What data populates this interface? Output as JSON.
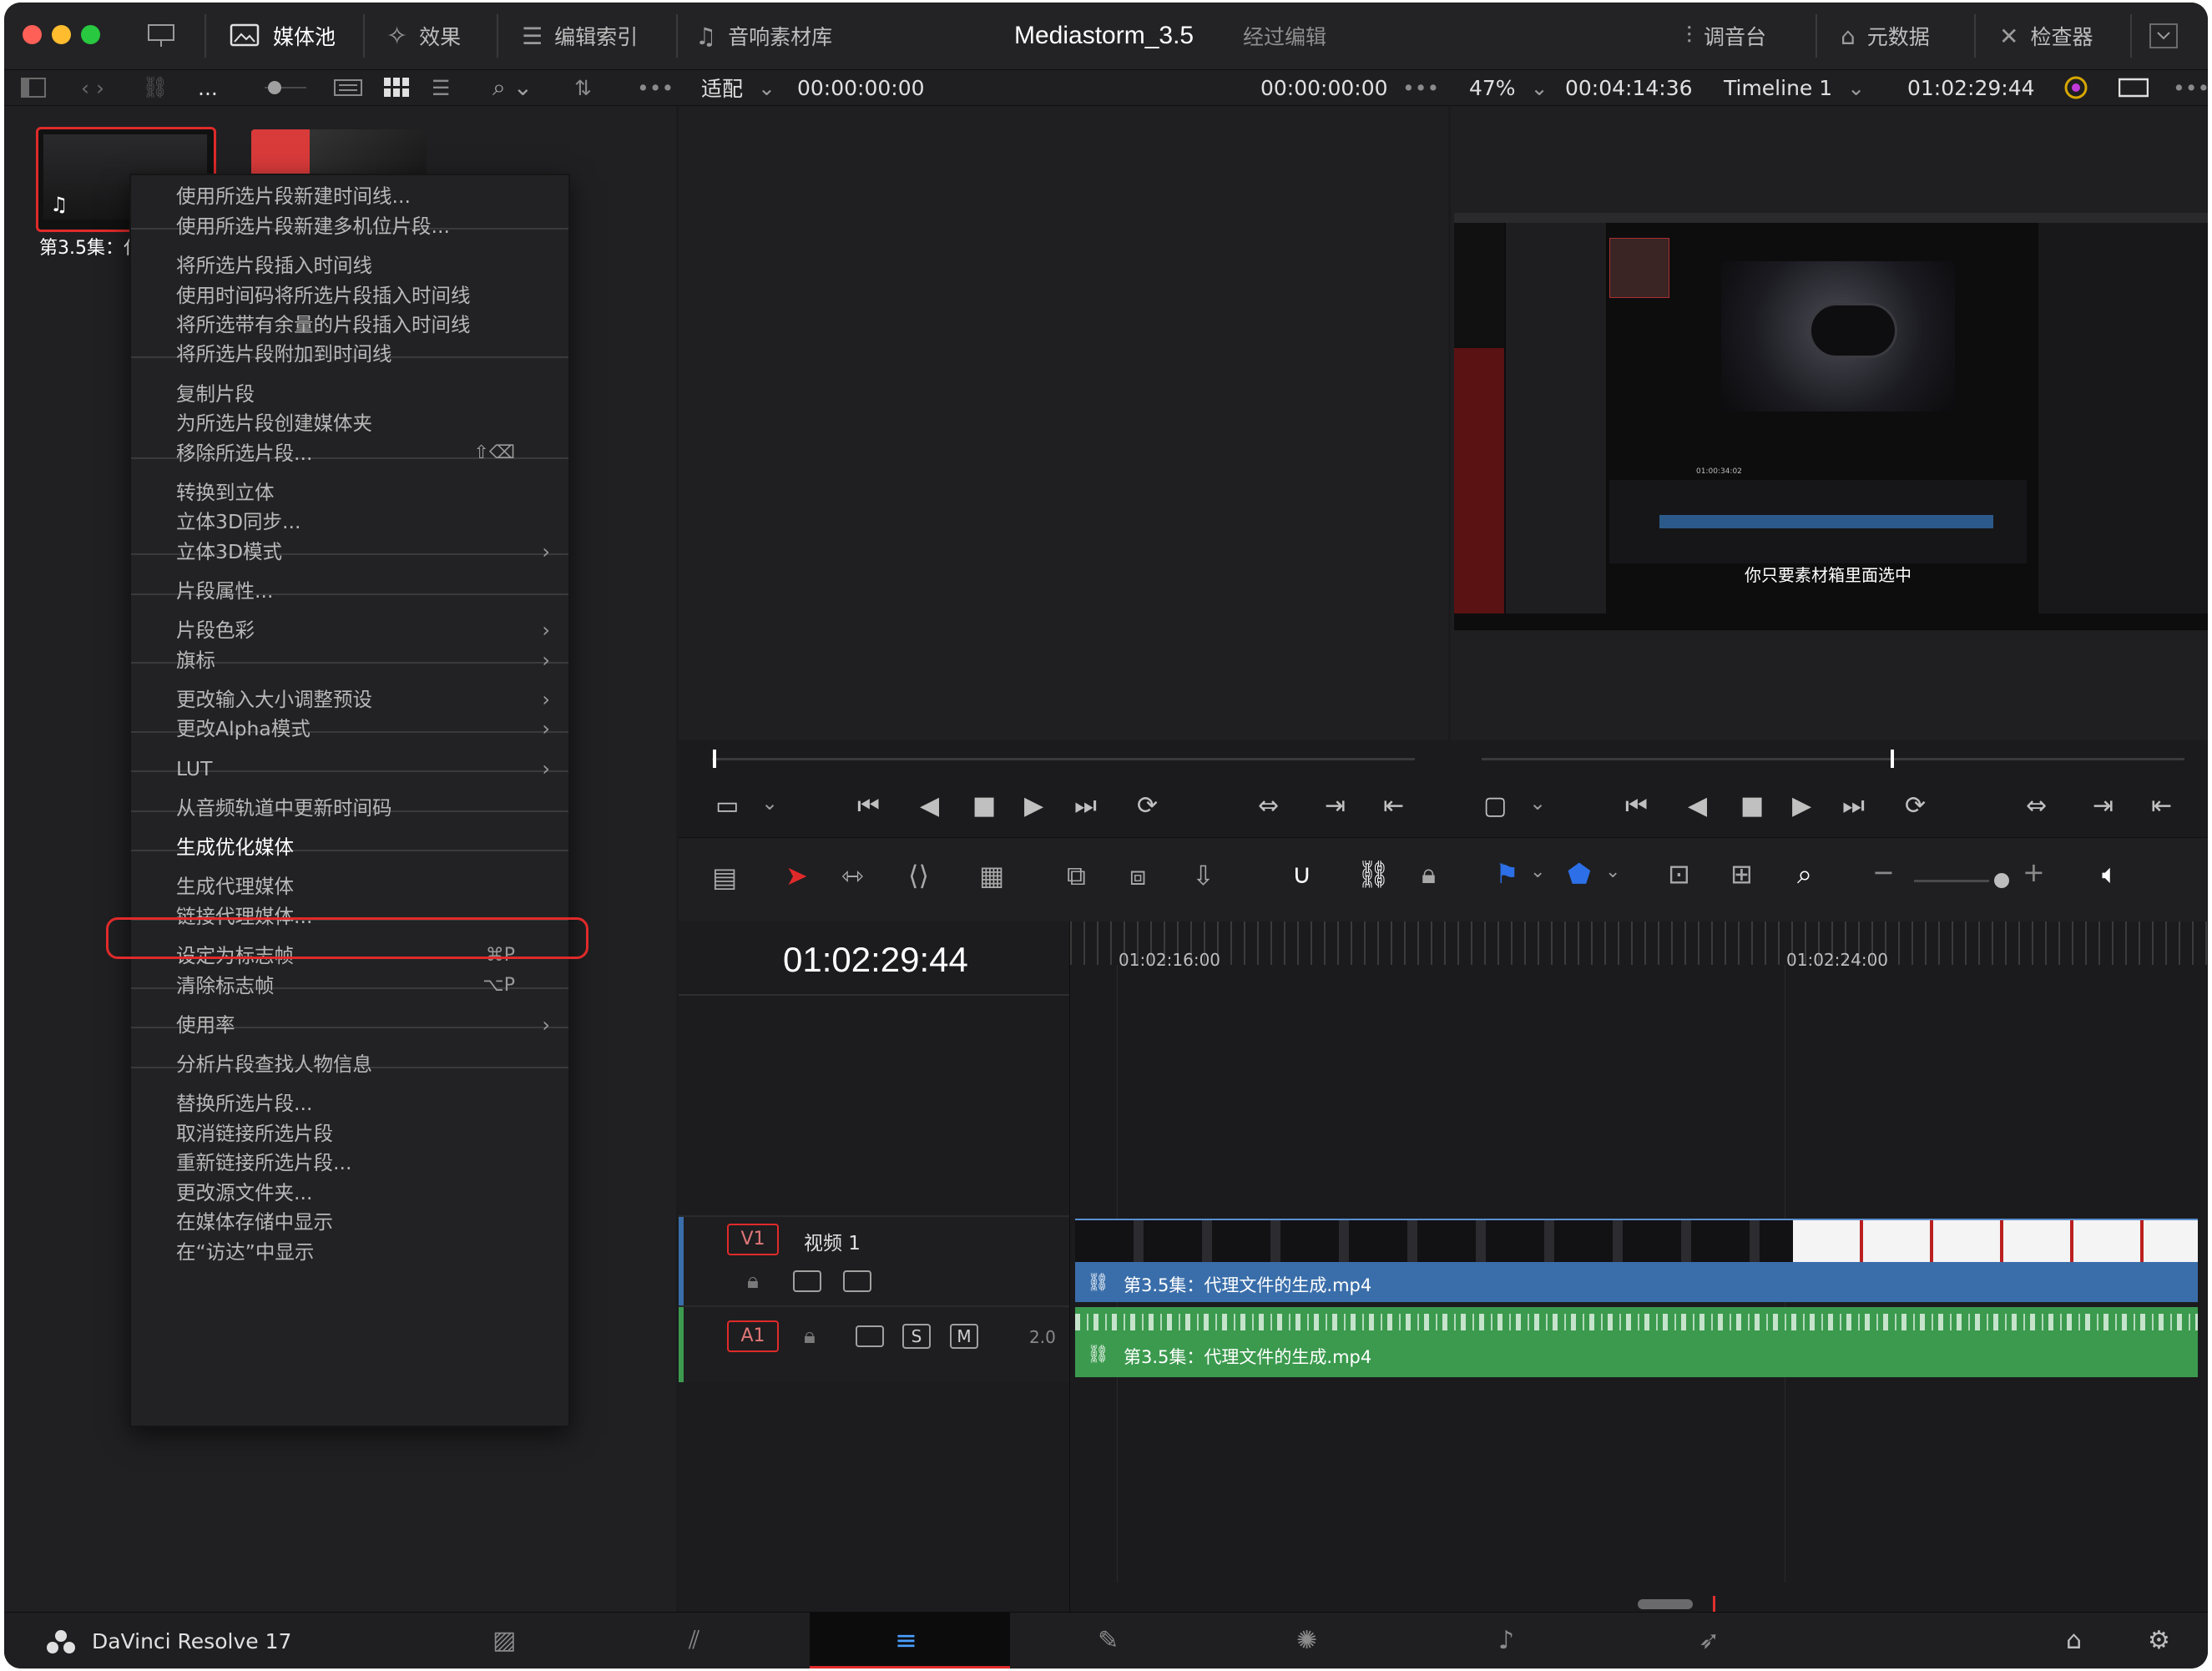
{
  "topbar": {
    "media_pool": "媒体池",
    "effects": "效果",
    "edit_index": "编辑索引",
    "sound_library": "音响素材库",
    "project_name": "Mediastorm_3.5",
    "project_status": "经过编辑",
    "mixer": "调音台",
    "metadata": "元数据",
    "inspector": "检查器"
  },
  "toolbar": {
    "ellipsis": "...",
    "fit": "适配",
    "source_tc": "00:00:00:00",
    "viewer_tc": "00:00:00:00",
    "zoom": "47%",
    "duration": "00:04:14:36",
    "timeline_name": "Timeline 1",
    "timeline_tc": "01:02:29:44"
  },
  "media_pool": {
    "clip1_label": "第3.5集：代"
  },
  "context_menu": {
    "items": [
      "使用所选片段新建时间线...",
      "使用所选片段新建多机位片段...",
      "将所选片段插入时间线",
      "使用时间码将所选片段插入时间线",
      "将所选带有余量的片段插入时间线",
      "将所选片段附加到时间线",
      "复制片段",
      "为所选片段创建媒体夹",
      "移除所选片段...",
      "转换到立体",
      "立体3D同步...",
      "立体3D模式",
      "片段属性...",
      "片段色彩",
      "旗标",
      "更改输入大小调整预设",
      "更改Alpha模式",
      "LUT",
      "从音频轨道中更新时间码",
      "生成优化媒体",
      "生成代理媒体",
      "链接代理媒体...",
      "设定为标志帧",
      "清除标志帧",
      "使用率",
      "分析片段查找人物信息",
      "替换所选片段...",
      "取消链接所选片段",
      "重新链接所选片段...",
      "更改源文件夹...",
      "在媒体存储中显示",
      "在“访达”中显示"
    ],
    "shortcut_remove": "⇧⌫",
    "shortcut_set_poster": "⌘P",
    "shortcut_clear_poster": "⌥P"
  },
  "viewer": {
    "subtitle": "你只要素材箱里面选中",
    "embedded_tc": "01:00:34:02"
  },
  "timeline": {
    "current_tc": "01:02:29:44",
    "ruler_1": "01:02:16:00",
    "ruler_2": "01:02:24:00",
    "v1_label": "V1",
    "v1_name": "视频 1",
    "a1_label": "A1",
    "a1_solo": "S",
    "a1_mute": "M",
    "a1_channels": "2.0",
    "video_clip": "第3.5集：代理文件的生成.mp4",
    "audio_clip": "第3.5集：代理文件的生成.mp4"
  },
  "footer": {
    "app_name": "DaVinci Resolve 17"
  },
  "colors": {
    "accent_red": "#e02a2a",
    "video_clip": "#3a6eaa",
    "audio_clip": "#3b9a4e",
    "playhead": "#e03030"
  }
}
